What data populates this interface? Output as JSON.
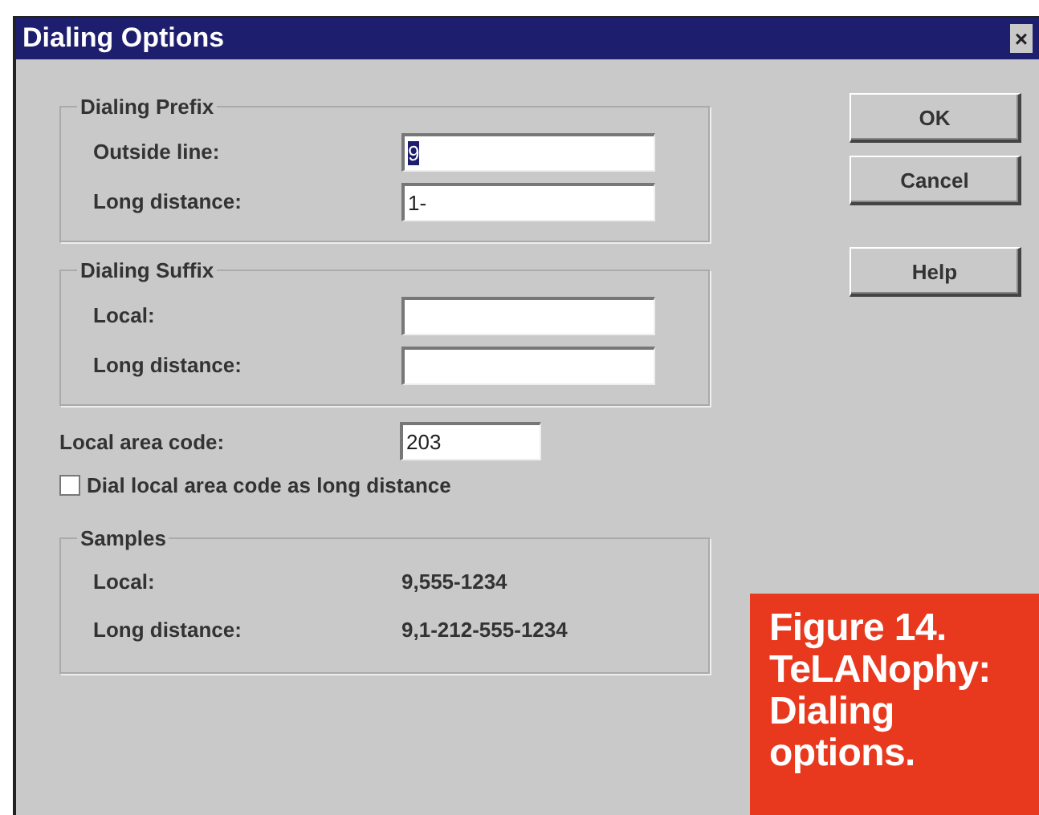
{
  "window": {
    "title": "Dialing Options",
    "close": "×"
  },
  "prefix": {
    "title": "Dialing Prefix",
    "fields": [
      {
        "label": "Outside line:",
        "value": "9",
        "selected": true
      },
      {
        "label": "Long distance:",
        "value": "1-",
        "selected": false
      }
    ]
  },
  "suffix": {
    "title": "Dialing Suffix",
    "fields": [
      {
        "label": "Local:"
      },
      {
        "label": "Long distance:"
      }
    ]
  },
  "area_code": {
    "label": "Local area code:",
    "value": "203"
  },
  "checkbox": {
    "label": "Dial local area code as long distance",
    "checked": false
  },
  "samples": {
    "title": "Samples",
    "rows": [
      {
        "label": "Local:",
        "value": "9,555-1234"
      },
      {
        "label": "Long distance:",
        "value": "9,1-212-555-1234"
      }
    ]
  },
  "buttons": [
    "OK",
    "Cancel",
    "Help"
  ],
  "caption": [
    "Figure 14.",
    "TeLANophy:",
    "Dialing",
    "options."
  ]
}
